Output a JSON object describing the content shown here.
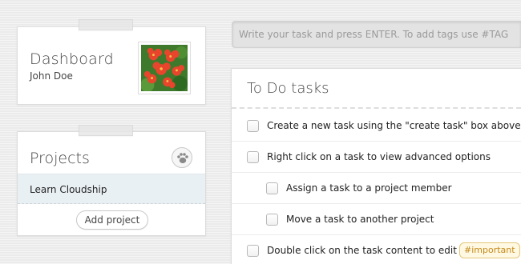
{
  "dashboard": {
    "title": "Dashboard",
    "user_name": "John Doe"
  },
  "projects": {
    "title": "Projects",
    "items": [
      {
        "label": "Learn Cloudship"
      }
    ],
    "add_label": "Add project"
  },
  "task_input": {
    "placeholder": "Write your task and press ENTER. To add tags use #TAG"
  },
  "todo": {
    "title": "To Do tasks",
    "tasks": [
      {
        "text": "Create a new task using the \"create task\" box above",
        "indent": 0
      },
      {
        "text": "Right click on a task to view advanced options",
        "indent": 0
      },
      {
        "text": "Assign a task to a project member",
        "indent": 1
      },
      {
        "text": "Move a task to another project",
        "indent": 1
      },
      {
        "text": "Double click on the task content to edit it",
        "indent": 0,
        "tag": "#important"
      }
    ]
  },
  "colors": {
    "accent_tag": "#c58a1b",
    "project_highlight": "#e9f0f3"
  },
  "icons": {
    "avatar": "flower-photo",
    "project_icon": "paw-icon"
  }
}
